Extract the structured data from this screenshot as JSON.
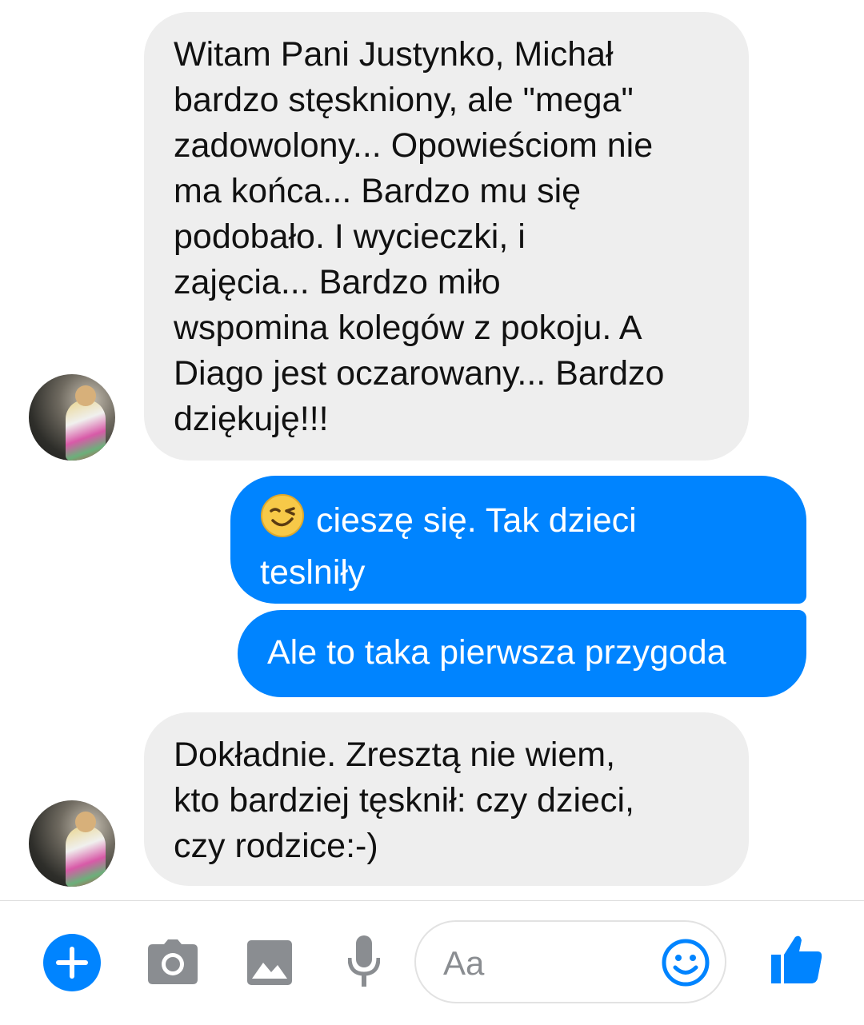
{
  "messages": [
    {
      "side": "incoming",
      "text": "Witam Pani Justynko, Michał\nbardzo stęskniony, ale \"mega\"\nzadowolony... Opowieściom nie\nma końca... Bardzo mu się\npodobało. I wycieczki, i\nzajęcia... Bardzo miło\nwspomina kolegów z pokoju. A\nDiago jest oczarowany... Bardzo\ndziękuję!!!"
    },
    {
      "side": "outgoing",
      "emoji": "wink-emoji",
      "text": "cieszę się. Tak dzieci\nteslniły"
    },
    {
      "side": "outgoing",
      "text": "Ale to taka pierwsza przygoda"
    },
    {
      "side": "incoming",
      "text": "Dokładnie. Zresztą nie wiem,\nkto bardziej tęsknił: czy dzieci,\nczy rodzice:-)"
    }
  ],
  "composer": {
    "placeholder": "Aa",
    "icons": [
      "plus-icon",
      "camera-icon",
      "image-icon",
      "microphone-icon",
      "emoji-icon",
      "thumbs-up-icon"
    ]
  },
  "colors": {
    "accent": "#0084ff",
    "incoming_bubble": "#eeeeee",
    "icon_gray": "#8a8d91"
  }
}
